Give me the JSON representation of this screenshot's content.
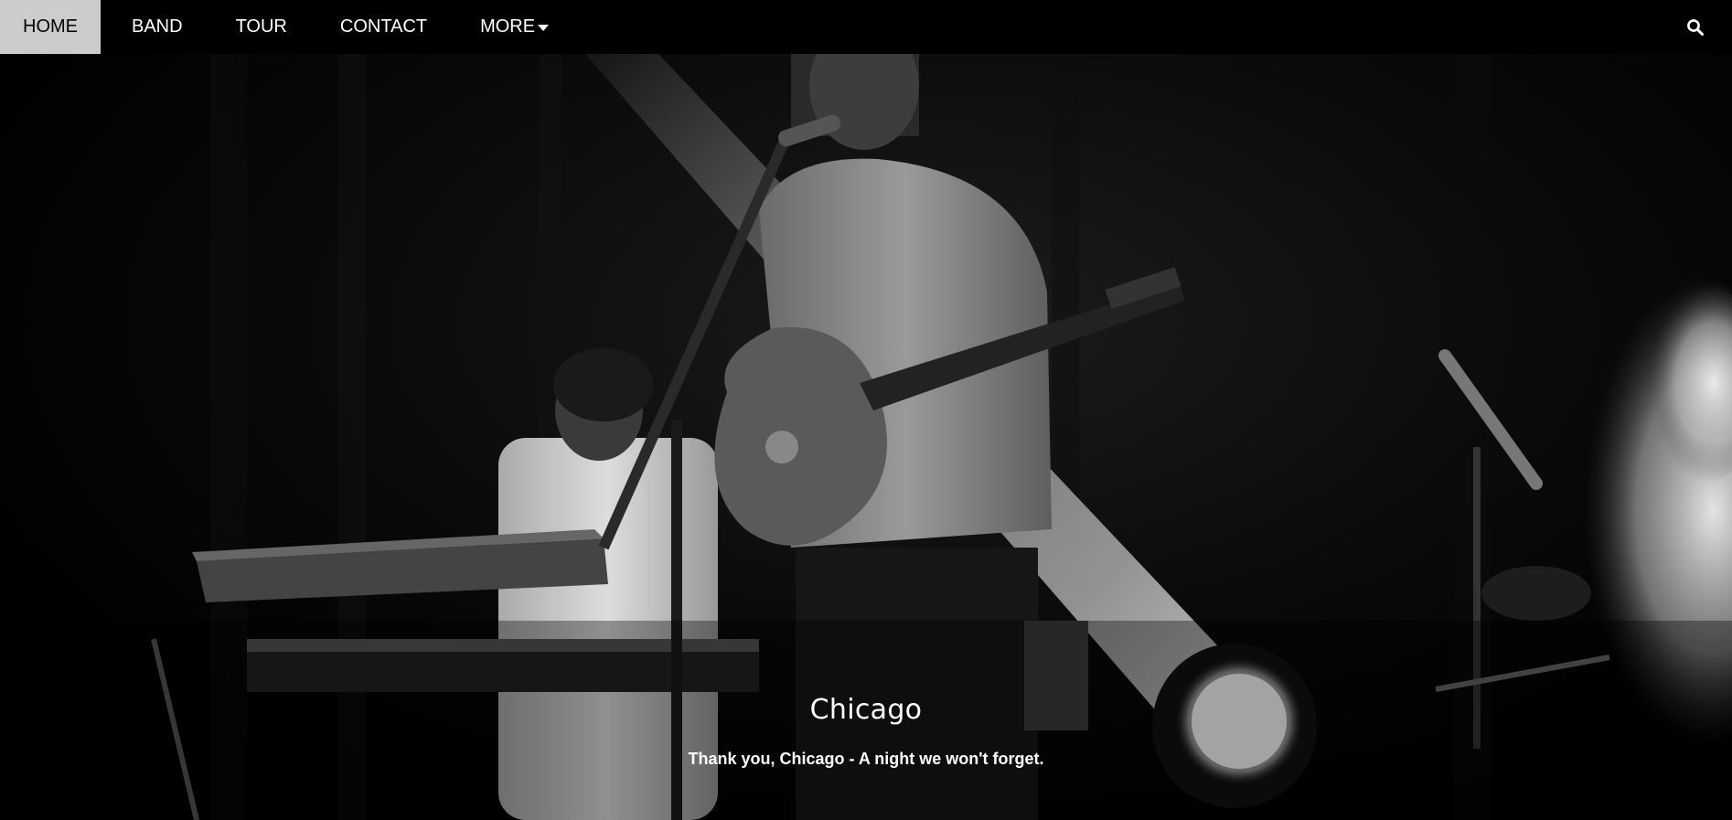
{
  "nav": {
    "items": [
      {
        "label": "HOME"
      },
      {
        "label": "BAND"
      },
      {
        "label": "TOUR"
      },
      {
        "label": "CONTACT"
      }
    ],
    "more_label": "MORE",
    "search_icon": "search-icon"
  },
  "hero": {
    "title": "Chicago",
    "text": "Thank you, Chicago - A night we won't forget.",
    "image_style": "black-and-white concert photo"
  },
  "colors": {
    "navbar_bg": "#000000",
    "nav_text": "#ffffff",
    "caption_text": "#ffffff"
  }
}
